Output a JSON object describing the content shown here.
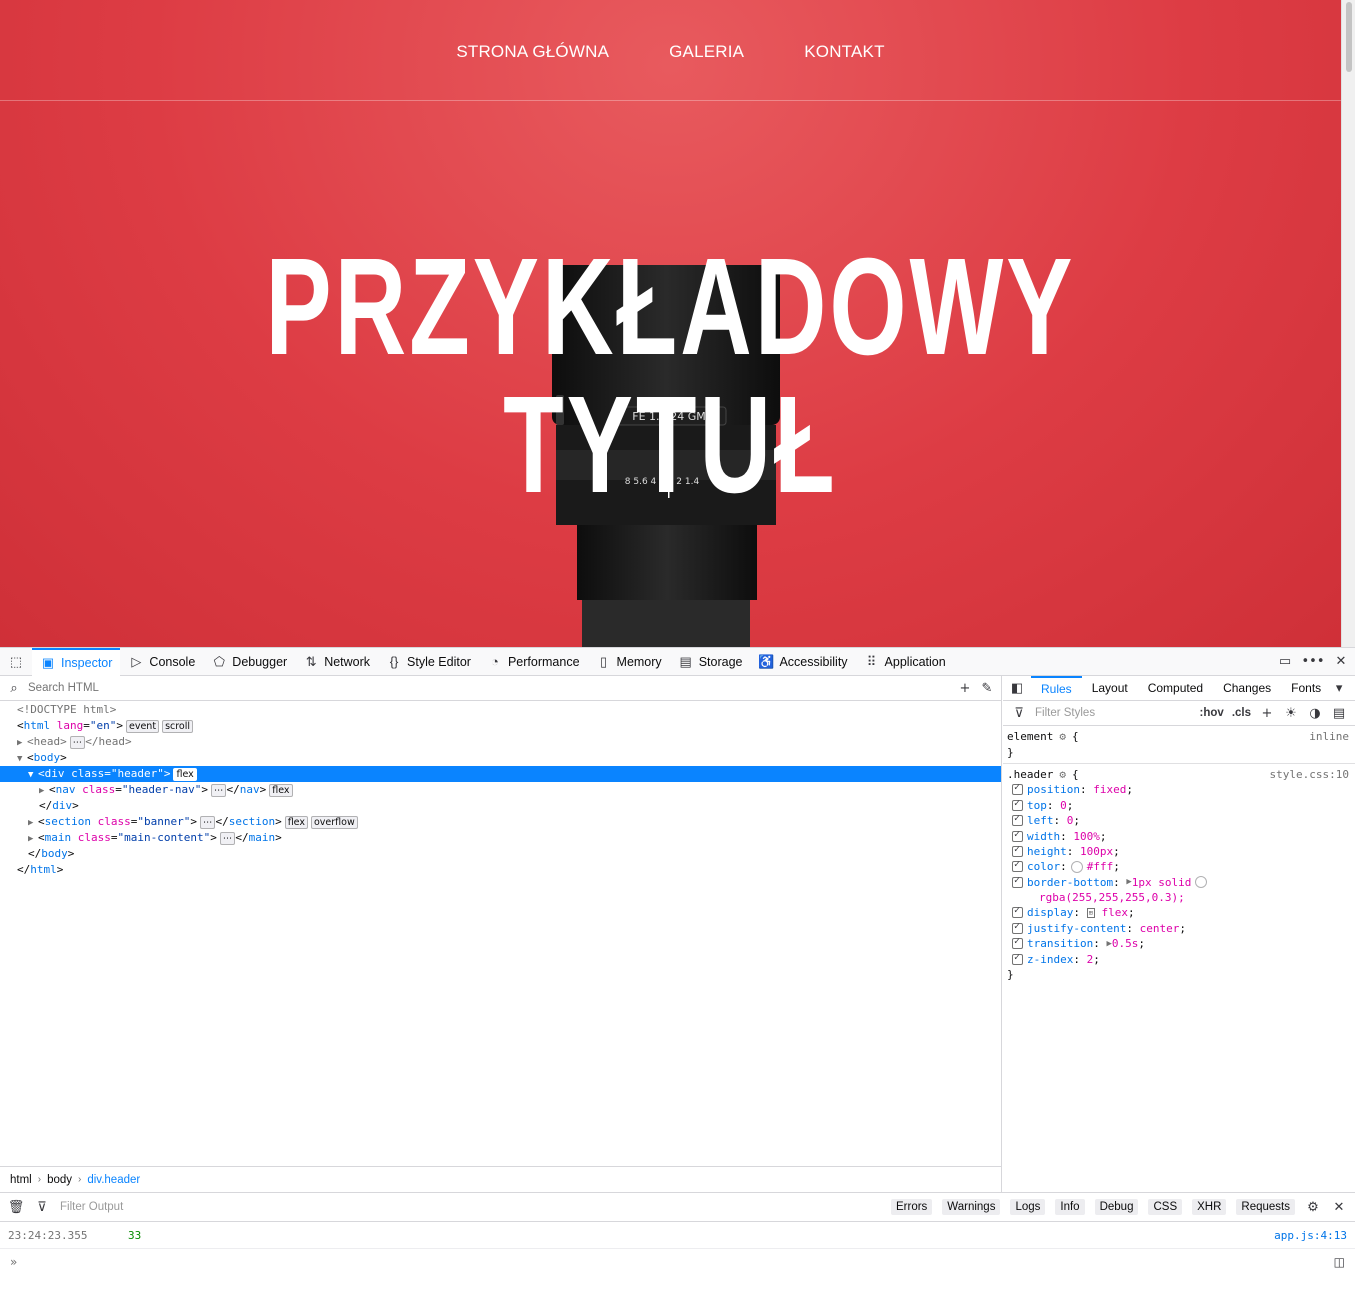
{
  "page": {
    "nav": [
      "STRONA GŁÓWNA",
      "GALERIA",
      "KONTAKT"
    ],
    "hero_title": "PRZYKŁADOWY TYTUŁ",
    "lens_label": "FE 1.4/24 GM",
    "lens_scale": "8  5.6  4  2.8  2  1.4"
  },
  "devtools": {
    "tabs": [
      "Inspector",
      "Console",
      "Debugger",
      "Network",
      "Style Editor",
      "Performance",
      "Memory",
      "Storage",
      "Accessibility",
      "Application"
    ],
    "search_placeholder": "Search HTML",
    "markup": {
      "doctype": "<!DOCTYPE html>",
      "html_open_tag": "html",
      "html_attr": "lang",
      "html_attr_val": "\"en\"",
      "badge_event": "event",
      "badge_scroll": "scroll",
      "head": "head",
      "body": "body",
      "div_tag": "div",
      "div_attr": "class",
      "div_attr_val": "\"header\"",
      "badge_flex": "flex",
      "nav_tag": "nav",
      "nav_attr_val": "\"header-nav\"",
      "section_tag": "section",
      "section_attr_val": "\"banner\"",
      "badge_overflow": "overflow",
      "main_tag": "main",
      "main_attr_val": "\"main-content\""
    },
    "breadcrumbs": [
      "html",
      "body",
      "div.header"
    ],
    "rules_tabs": [
      "Rules",
      "Layout",
      "Computed",
      "Changes",
      "Fonts"
    ],
    "filter_styles": "Filter Styles",
    "hov": ":hov",
    "cls": ".cls",
    "element_selector": "element",
    "element_source": "inline",
    "header_selector": ".header",
    "header_source": "style.css:10",
    "declarations": [
      {
        "p": "position",
        "v": "fixed"
      },
      {
        "p": "top",
        "v": "0"
      },
      {
        "p": "left",
        "v": "0"
      },
      {
        "p": "width",
        "v": "100%"
      },
      {
        "p": "height",
        "v": "100px"
      },
      {
        "p": "color",
        "v": "#fff"
      },
      {
        "p": "border-bottom",
        "v": "1px solid"
      },
      {
        "p": "display",
        "v": "flex"
      },
      {
        "p": "justify-content",
        "v": "center"
      },
      {
        "p": "transition",
        "v": "0.5s"
      },
      {
        "p": "z-index",
        "v": "2"
      }
    ],
    "border_bottom_cont": "rgba(255,255,255,0.3);",
    "console": {
      "filter_placeholder": "Filter Output",
      "filters": [
        "Errors",
        "Warnings",
        "Logs",
        "Info",
        "Debug",
        "CSS",
        "XHR",
        "Requests"
      ],
      "timestamp": "23:24:23.355",
      "value": "33",
      "location": "app.js:4:13"
    }
  }
}
